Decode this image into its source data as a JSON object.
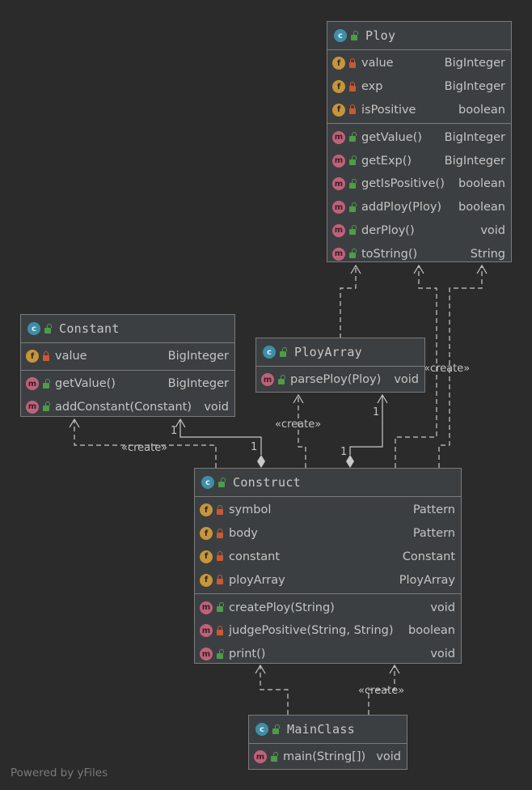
{
  "classes": {
    "ploy": {
      "name": "Ploy",
      "fields": [
        {
          "name": "value",
          "type": "BigInteger",
          "visibility": "private"
        },
        {
          "name": "exp",
          "type": "BigInteger",
          "visibility": "private"
        },
        {
          "name": "isPositive",
          "type": "boolean",
          "visibility": "private"
        }
      ],
      "methods": [
        {
          "name": "getValue()",
          "type": "BigInteger",
          "visibility": "public"
        },
        {
          "name": "getExp()",
          "type": "BigInteger",
          "visibility": "public"
        },
        {
          "name": "getIsPositive()",
          "type": "boolean",
          "visibility": "public"
        },
        {
          "name": "addPloy(Ploy)",
          "type": "boolean",
          "visibility": "public"
        },
        {
          "name": "derPloy()",
          "type": "void",
          "visibility": "public"
        },
        {
          "name": "toString()",
          "type": "String",
          "visibility": "public"
        }
      ]
    },
    "constant": {
      "name": "Constant",
      "fields": [
        {
          "name": "value",
          "type": "BigInteger",
          "visibility": "private"
        }
      ],
      "methods": [
        {
          "name": "getValue()",
          "type": "BigInteger",
          "visibility": "public"
        },
        {
          "name": "addConstant(Constant)",
          "type": "void",
          "visibility": "public"
        }
      ]
    },
    "ployarray": {
      "name": "PloyArray",
      "fields": [],
      "methods": [
        {
          "name": "parsePloy(Ploy)",
          "type": "void",
          "visibility": "public"
        }
      ]
    },
    "construct": {
      "name": "Construct",
      "fields": [
        {
          "name": "symbol",
          "type": "Pattern",
          "visibility": "private"
        },
        {
          "name": "body",
          "type": "Pattern",
          "visibility": "private"
        },
        {
          "name": "constant",
          "type": "Constant",
          "visibility": "private"
        },
        {
          "name": "ployArray",
          "type": "PloyArray",
          "visibility": "private"
        }
      ],
      "methods": [
        {
          "name": "createPloy(String)",
          "type": "void",
          "visibility": "public"
        },
        {
          "name": "judgePositive(String, String)",
          "type": "boolean",
          "visibility": "private"
        },
        {
          "name": "print()",
          "type": "void",
          "visibility": "public"
        }
      ]
    },
    "mainclass": {
      "name": "MainClass",
      "fields": [],
      "methods": [
        {
          "name": "main(String[])",
          "type": "void",
          "visibility": "public"
        }
      ]
    }
  },
  "labels": {
    "create": "«create»",
    "one": "1"
  },
  "footer": "Powered by yFiles",
  "colors": {
    "background": "#2b2b2b",
    "box": "#3c3f41",
    "class_icon": "#3f8ea8",
    "field_icon": "#c7953a",
    "method_icon": "#c0617a",
    "public_lock": "#4e9c49",
    "private_lock": "#c75a35"
  }
}
